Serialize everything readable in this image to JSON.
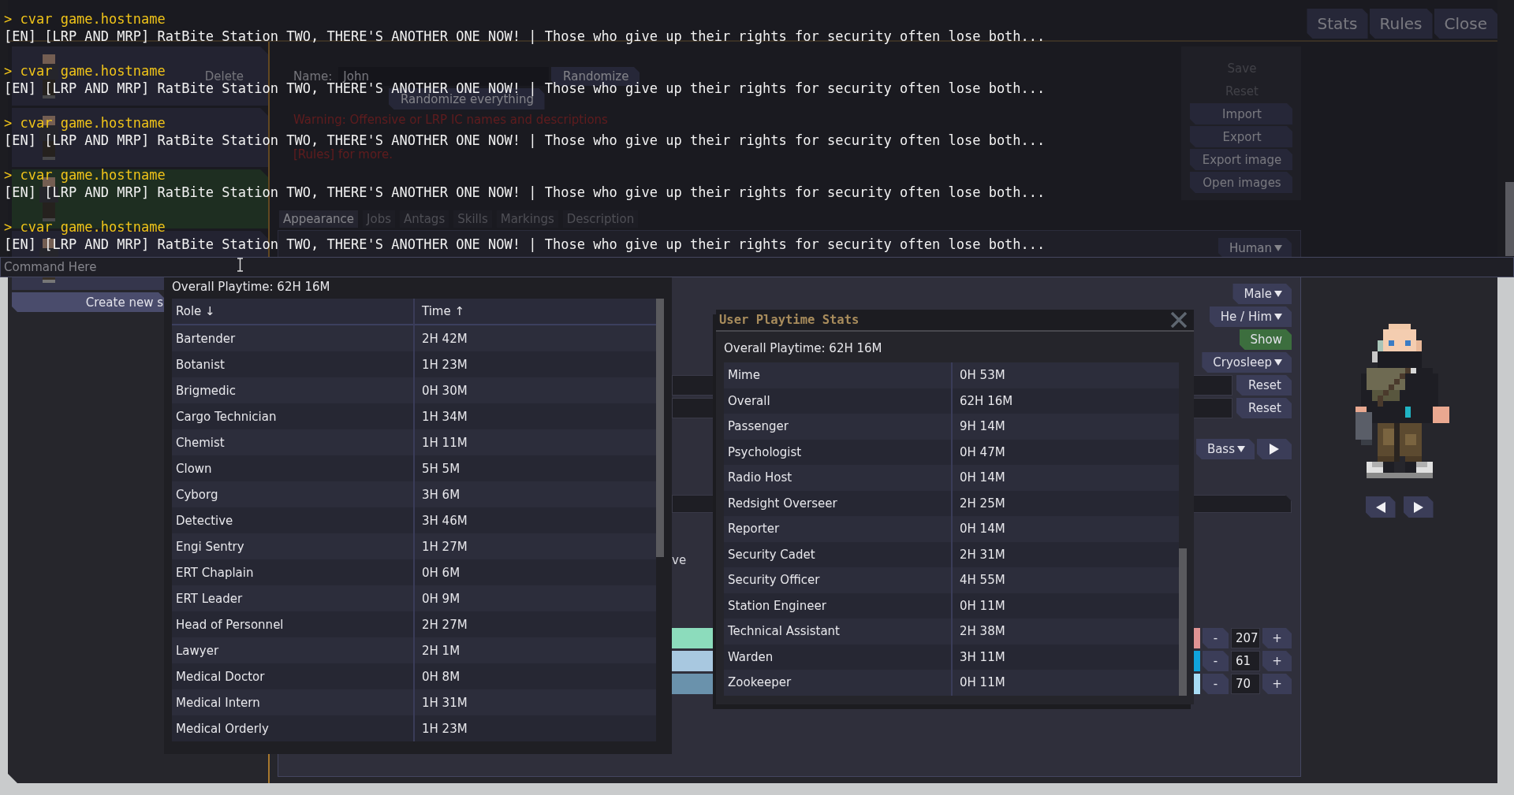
{
  "console": {
    "entries": [
      {
        "command": "> cvar game.hostname",
        "output": "[EN] [LRP AND MRP] RatBite Station TWO, THERE'S ANOTHER ONE NOW! | Those who give up their rights for security often lose both..."
      },
      {
        "command": "> cvar game.hostname",
        "output": "[EN] [LRP AND MRP] RatBite Station TWO, THERE'S ANOTHER ONE NOW! | Those who give up their rights for security often lose both..."
      },
      {
        "command": "> cvar game.hostname",
        "output": "[EN] [LRP AND MRP] RatBite Station TWO, THERE'S ANOTHER ONE NOW! | Those who give up their rights for security often lose both..."
      },
      {
        "command": "> cvar game.hostname",
        "output": "[EN] [LRP AND MRP] RatBite Station TWO, THERE'S ANOTHER ONE NOW! | Those who give up their rights for security often lose both..."
      },
      {
        "command": "> cvar game.hostname",
        "output": "[EN] [LRP AND MRP] RatBite Station TWO, THERE'S ANOTHER ONE NOW! | Those who give up their rights for security often lose both..."
      }
    ],
    "input": {
      "placeholder": "Command Here"
    }
  },
  "window": {
    "header_buttons": [
      "Stats",
      "Rules",
      "Close"
    ]
  },
  "characters": [
    {
      "selected": false,
      "delete_label": "Delete"
    },
    {
      "selected": false
    },
    {
      "selected": true
    },
    {
      "selected": false
    }
  ],
  "create_button": "Create new s",
  "profile": {
    "name_label": "Name:",
    "name_value": "John",
    "randomize": "Randomize",
    "randomize_everything": "Randomize everything",
    "warning": [
      "Warning: Offensive or LRP IC names and descriptions",
      "[Rules] for more."
    ]
  },
  "actions": [
    {
      "label": "Save",
      "disabled": true
    },
    {
      "label": "Reset",
      "disabled": true
    },
    {
      "label": "Import",
      "disabled": false
    },
    {
      "label": "Export",
      "disabled": false
    },
    {
      "label": "Export image",
      "disabled": false
    },
    {
      "label": "Open images",
      "disabled": false
    }
  ],
  "tabs": [
    {
      "label": "Appearance",
      "selected": true
    },
    {
      "label": "Jobs",
      "selected": false
    },
    {
      "label": "Antags",
      "selected": false
    },
    {
      "label": "Skills",
      "selected": false
    },
    {
      "label": "Markings",
      "selected": false
    },
    {
      "label": "Description",
      "selected": false
    }
  ],
  "appearance": [
    {
      "kind": "dropdown",
      "label": "Human"
    },
    {
      "kind": "dropdown",
      "label": "Male"
    },
    {
      "kind": "dropdown",
      "label": "He / Him"
    },
    {
      "kind": "toggle",
      "label": "Show",
      "on": true
    },
    {
      "kind": "dropdown",
      "label": "Cryosleep"
    },
    {
      "kind": "field_reset",
      "label": "Reset"
    },
    {
      "kind": "field_reset",
      "label": "Reset"
    },
    {
      "kind": "voice",
      "label": "Bass"
    },
    {
      "kind": "field"
    },
    {
      "kind": "label",
      "text": "ve"
    },
    {
      "kind": "slider",
      "minus": "-",
      "value": "207",
      "plus": "+"
    },
    {
      "kind": "slider",
      "minus": "-",
      "value": "61",
      "plus": "+"
    },
    {
      "kind": "slider",
      "minus": "-",
      "value": "70",
      "plus": "+"
    }
  ],
  "playtime_list": {
    "overall": "Overall Playtime: 62H 16M",
    "columns": [
      "Role ↓",
      "Time ↑"
    ],
    "rows": [
      {
        "role": "Bartender",
        "time": "2H 42M"
      },
      {
        "role": "Botanist",
        "time": "1H 23M"
      },
      {
        "role": "Brigmedic",
        "time": "0H 30M"
      },
      {
        "role": "Cargo Technician",
        "time": "1H 34M"
      },
      {
        "role": "Chemist",
        "time": "1H 11M"
      },
      {
        "role": "Clown",
        "time": "5H 5M"
      },
      {
        "role": "Cyborg",
        "time": "3H 6M"
      },
      {
        "role": "Detective",
        "time": "3H 46M"
      },
      {
        "role": "Engi Sentry",
        "time": "1H 27M"
      },
      {
        "role": "ERT Chaplain",
        "time": "0H 6M"
      },
      {
        "role": "ERT Leader",
        "time": "0H 9M"
      },
      {
        "role": "Head of Personnel",
        "time": "2H 27M"
      },
      {
        "role": "Lawyer",
        "time": "2H 1M"
      },
      {
        "role": "Medical Doctor",
        "time": "0H 8M"
      },
      {
        "role": "Medical Intern",
        "time": "1H 31M"
      },
      {
        "role": "Medical Orderly",
        "time": "1H 23M"
      }
    ]
  },
  "stats_window": {
    "title": "User Playtime Stats",
    "overall": "Overall Playtime: 62H 16M",
    "rows": [
      {
        "role": "Mime",
        "time": "0H 53M"
      },
      {
        "role": "Overall",
        "time": "62H 16M"
      },
      {
        "role": "Passenger",
        "time": "9H 14M"
      },
      {
        "role": "Psychologist",
        "time": "0H 47M"
      },
      {
        "role": "Radio Host",
        "time": "0H 14M"
      },
      {
        "role": "Redsight Overseer",
        "time": "2H 25M"
      },
      {
        "role": "Reporter",
        "time": "0H 14M"
      },
      {
        "role": "Security Cadet",
        "time": "2H 31M"
      },
      {
        "role": "Security Officer",
        "time": "4H 55M"
      },
      {
        "role": "Station Engineer",
        "time": "0H 11M"
      },
      {
        "role": "Technical Assistant",
        "time": "2H 38M"
      },
      {
        "role": "Warden",
        "time": "3H 11M"
      },
      {
        "role": "Zookeeper",
        "time": "0H 11M"
      }
    ]
  }
}
